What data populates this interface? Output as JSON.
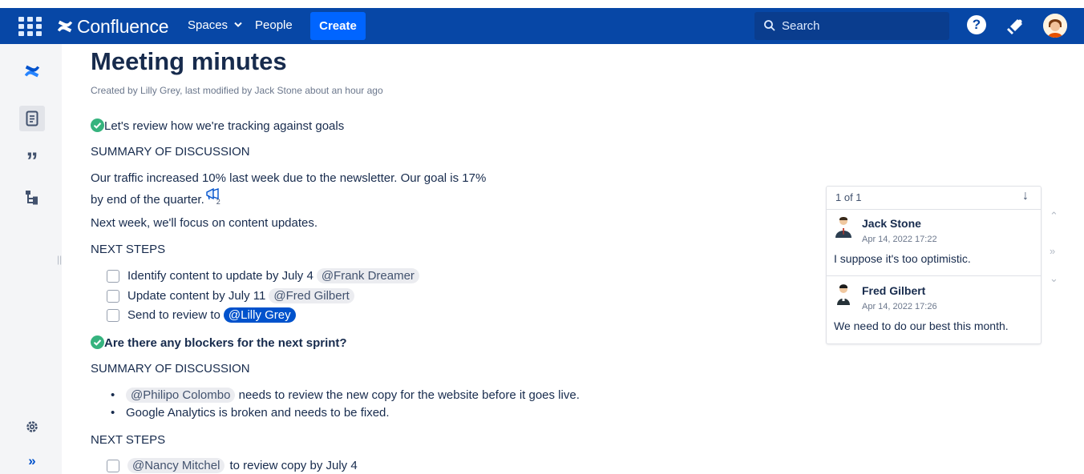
{
  "topbar": {
    "brand": "Confluence",
    "spaces": "Spaces",
    "people": "People",
    "create": "Create",
    "search_placeholder": "Search",
    "help": "?"
  },
  "page": {
    "title": "Meeting minutes",
    "byline": "Created by Lilly Grey, last modified by Jack Stone about an hour ago",
    "goal_heading": "Let's review how we're tracking against goals",
    "summary1_heading": "SUMMARY OF DISCUSSION",
    "traffic_line1": "Our traffic increased 10% last week due to the newsletter. Our goal is 17%",
    "traffic_line2": "by end of the quarter.",
    "comment_count_marker": "2",
    "next_week": "Next week, we'll focus on content updates.",
    "next_steps1_heading": "NEXT STEPS",
    "tasks1": [
      {
        "text": "Identify content to update by July 4",
        "mention": "@Frank Dreamer"
      },
      {
        "text": "Update content by July 11",
        "mention": "@Fred Gilbert"
      },
      {
        "text": "Send to review to",
        "mention": "@Lilly Grey"
      }
    ],
    "blockers_heading": "Are there any blockers for the next sprint?",
    "summary2_heading": "SUMMARY OF DISCUSSION",
    "bullets": [
      {
        "mention": "@Philipo Colombo",
        "text": "needs to review the new copy for the website before it goes live."
      },
      {
        "mention": "",
        "text": "Google Analytics is broken and needs to be fixed."
      }
    ],
    "next_steps2_heading": "NEXT STEPS",
    "tasks2": [
      {
        "mention": "@Nancy Mitchel",
        "text": "to review copy by July 4"
      }
    ]
  },
  "comments": {
    "counter": "1 of 1",
    "items": [
      {
        "author": "Jack Stone",
        "date": "Apr 14, 2022 17:22",
        "text": "I suppose it's too optimistic."
      },
      {
        "author": "Fred Gilbert",
        "date": "Apr 14, 2022 17:26",
        "text": "We need to do our best this month."
      }
    ]
  },
  "colors": {
    "nav_bg": "#0747a6",
    "create_bg": "#0065ff",
    "check_green": "#36b37e",
    "mention_self_bg": "#0052cc",
    "text": "#172b4d"
  },
  "icons": [
    "app-switcher-icon",
    "confluence-logo-icon",
    "chevron-down-icon",
    "search-icon",
    "help-icon",
    "notifications-icon",
    "avatar",
    "pages-icon",
    "quote-icon",
    "tree-icon",
    "settings-icon",
    "expand-icon",
    "check-circle-icon",
    "inline-comment-icon",
    "arrow-down-icon"
  ]
}
